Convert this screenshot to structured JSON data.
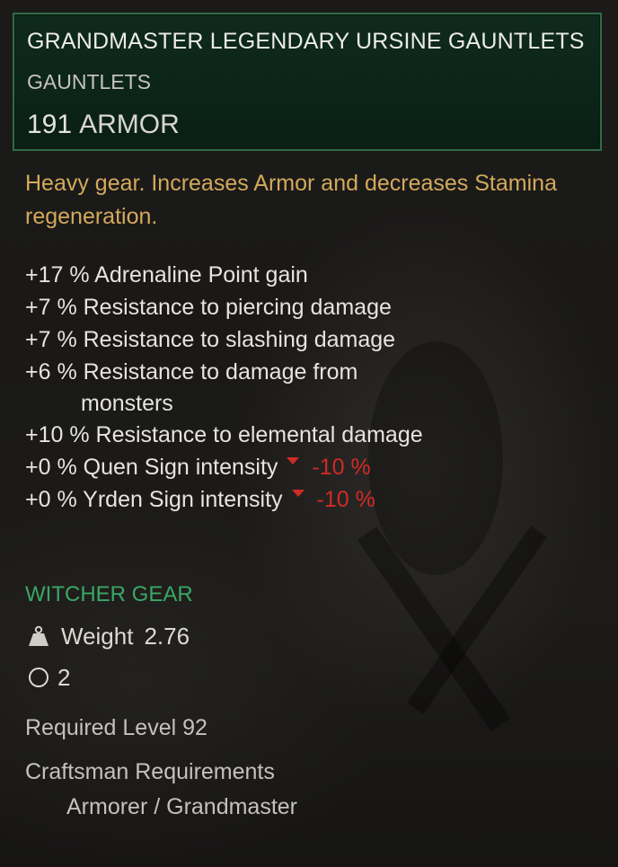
{
  "item": {
    "name": "GRANDMASTER LEGENDARY URSINE GAUNTLETS",
    "type": "GAUNTLETS",
    "armor_value": "191",
    "armor_unit": "ARMOR",
    "description": "Heavy gear. Increases Armor and decreases Stamina regeneration.",
    "header_border_color": "#2f6b46",
    "description_color": "#d3a95c"
  },
  "stats": [
    {
      "text": "+17 % Adrenaline Point gain"
    },
    {
      "text": "+7 % Resistance to piercing damage"
    },
    {
      "text": "+7 % Resistance to slashing damage"
    },
    {
      "text": "+6 % Resistance to damage from",
      "continuation": "monsters"
    },
    {
      "text": "+10 % Resistance to elemental damage"
    },
    {
      "text": "+0 % Quen Sign intensity",
      "penalty": "-10 %"
    },
    {
      "text": "+0 % Yrden Sign intensity",
      "penalty": "-10 %"
    }
  ],
  "penalty_color": "#d22a24",
  "set": {
    "label": "WITCHER GEAR",
    "color": "#3aa765"
  },
  "weight": {
    "icon": "weight-icon",
    "label": "Weight",
    "value": "2.76"
  },
  "sockets": {
    "icon": "socket-icon",
    "count": "2"
  },
  "requirements": {
    "level": "Required Level 92",
    "craftsman_label": "Craftsman Requirements",
    "craftsman_value": "Armorer / Grandmaster"
  }
}
